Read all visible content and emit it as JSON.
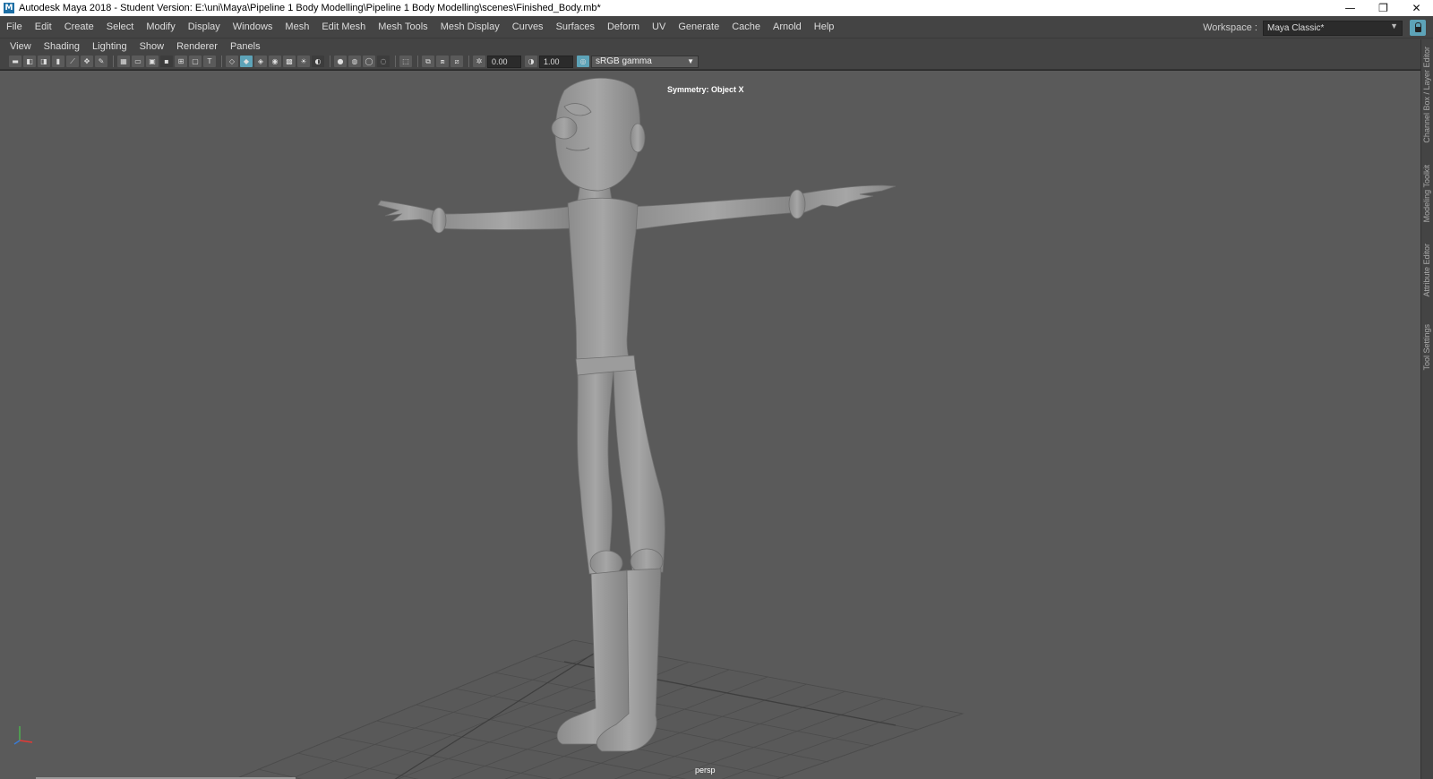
{
  "window": {
    "title": "Autodesk Maya 2018 - Student Version: E:\\uni\\Maya\\Pipeline 1 Body Modelling\\Pipeline 1 Body Modelling\\scenes\\Finished_Body.mb*",
    "app_icon": "M",
    "buttons": {
      "minimize": "—",
      "restore": "❐",
      "close": "✕"
    }
  },
  "menubar": {
    "items": [
      "File",
      "Edit",
      "Create",
      "Select",
      "Modify",
      "Display",
      "Windows",
      "Mesh",
      "Edit Mesh",
      "Mesh Tools",
      "Mesh Display",
      "Curves",
      "Surfaces",
      "Deform",
      "UV",
      "Generate",
      "Cache",
      "Arnold",
      "Help"
    ]
  },
  "workspace": {
    "label": "Workspace :",
    "value": "Maya Classic*"
  },
  "panel_menu": {
    "items": [
      "View",
      "Shading",
      "Lighting",
      "Show",
      "Renderer",
      "Panels"
    ]
  },
  "toolbar": {
    "exposure": "0.00",
    "gamma": "1.00",
    "color_space": "sRGB gamma"
  },
  "viewport": {
    "symmetry": "Symmetry: Object X",
    "camera": "persp",
    "background_color": "#5a5a5a",
    "mesh_color": "#9a9a9a"
  },
  "right_dock": {
    "tabs": [
      "Channel Box / Layer Editor",
      "Modeling Toolkit",
      "Attribute Editor",
      "Tool Settings"
    ]
  },
  "colors": {
    "accent": "#5da3b8",
    "ui_bg": "#444444"
  }
}
